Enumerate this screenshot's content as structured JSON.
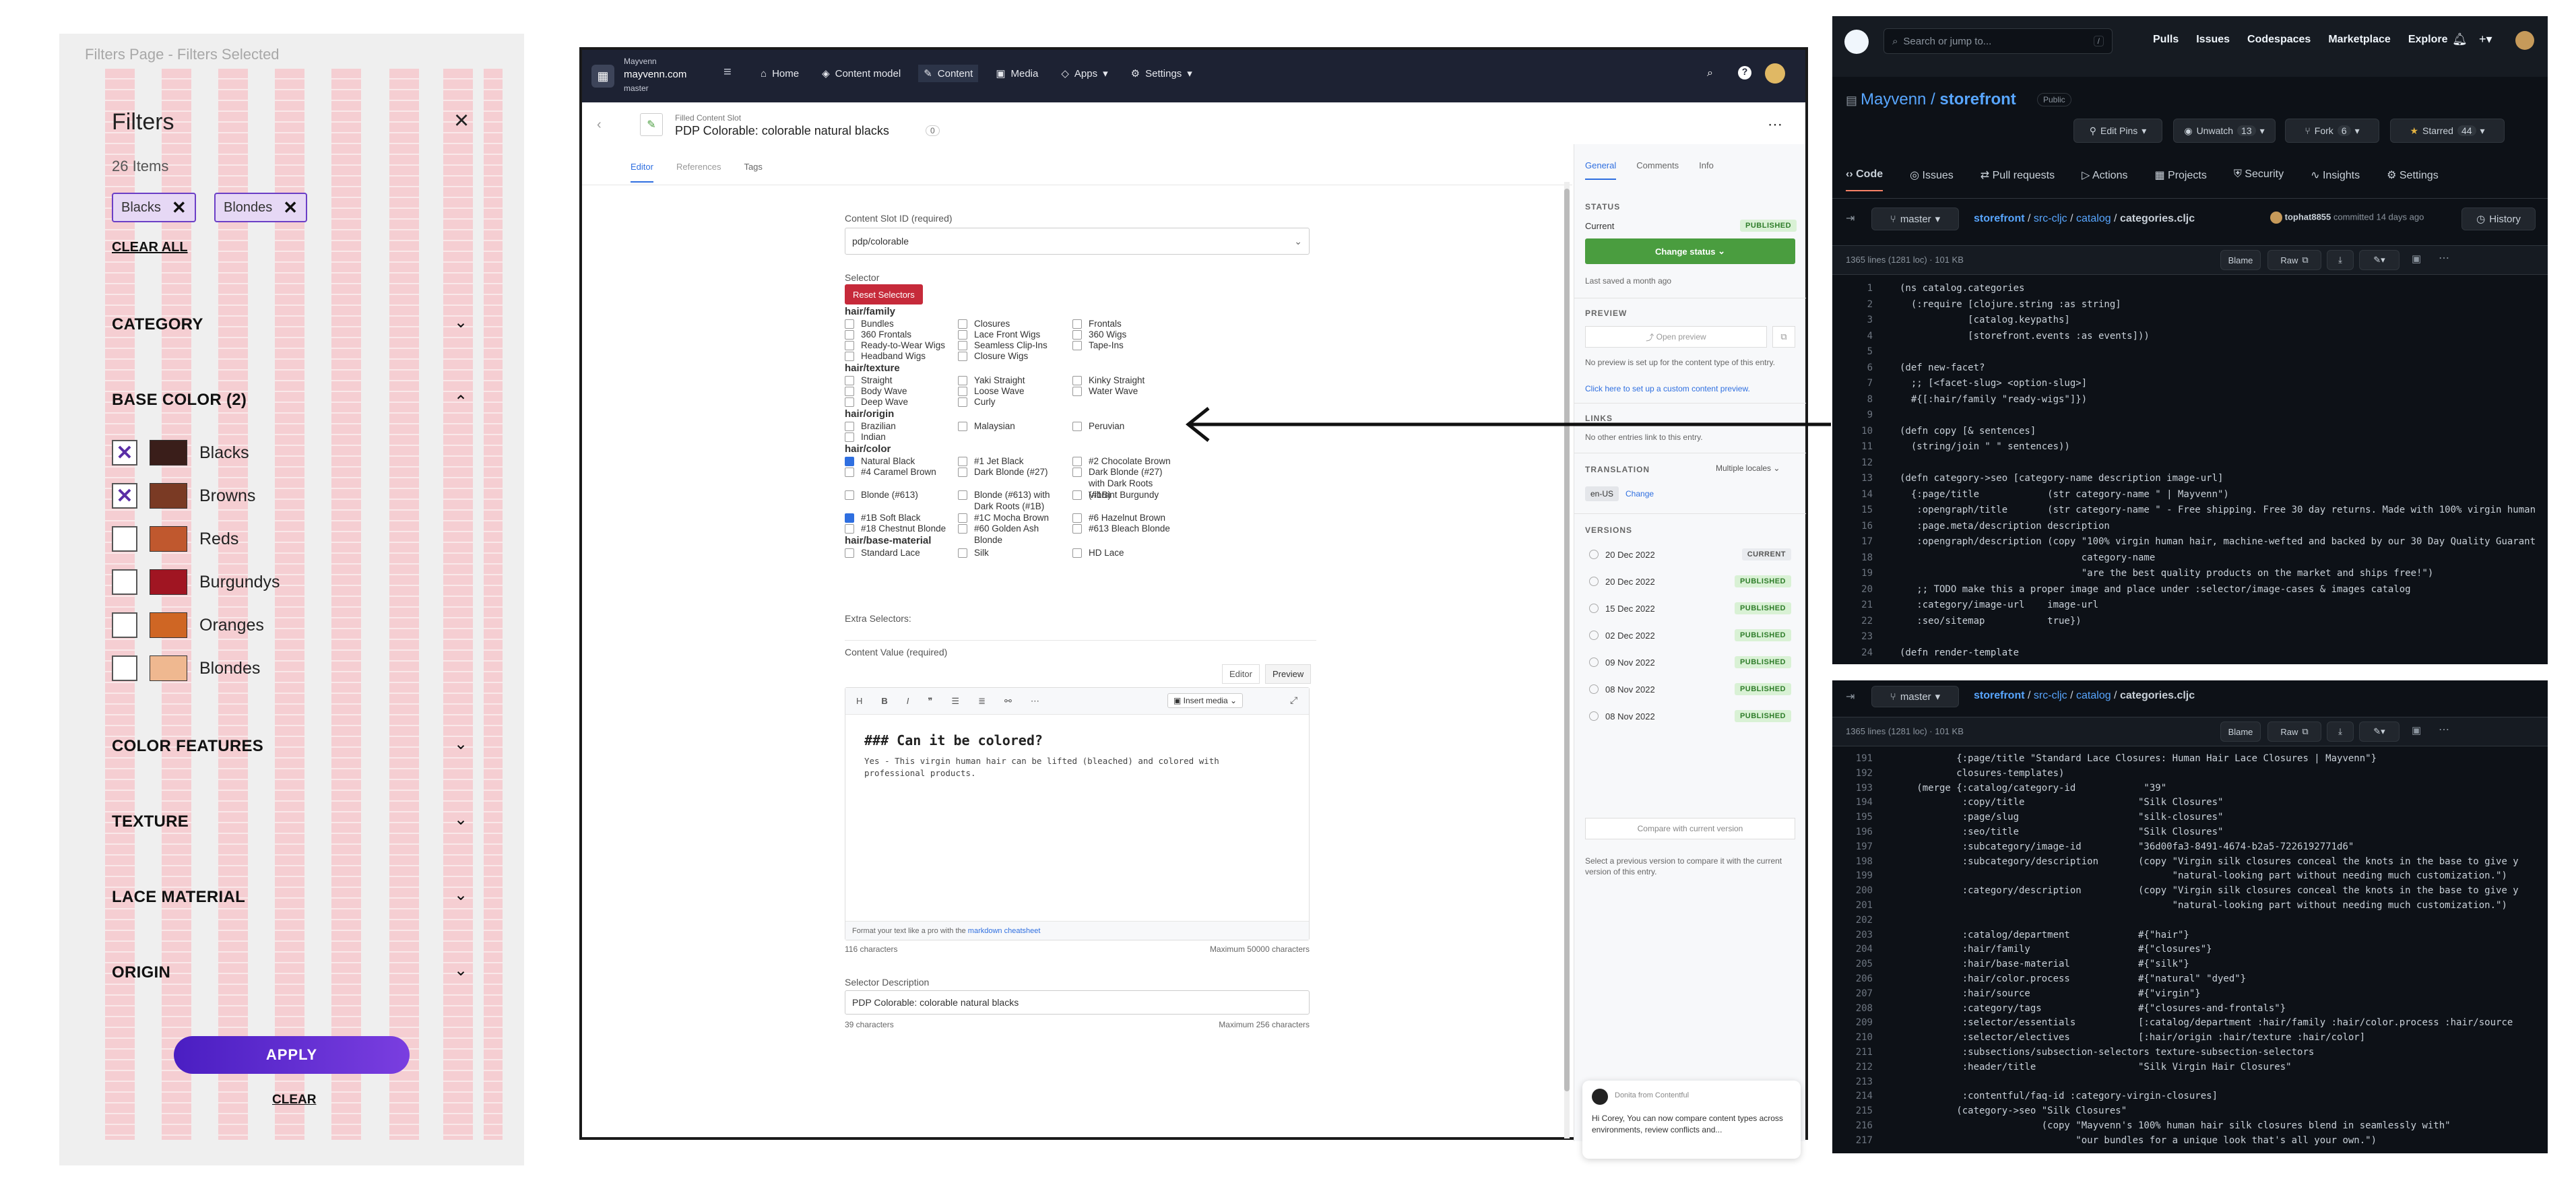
{
  "filters_panel": {
    "caption": "Filters Page - Filters Selected",
    "title": "Filters",
    "count": "26 Items",
    "chips": [
      "Blacks",
      "Blondes"
    ],
    "clear_all": "CLEAR ALL",
    "sections": {
      "category": "CATEGORY",
      "base_color": "BASE COLOR (2)",
      "color_features": "COLOR FEATURES",
      "texture": "TEXTURE",
      "lace_material": "LACE MATERIAL",
      "origin": "ORIGIN"
    },
    "colors": [
      {
        "label": "Blacks",
        "checked": true,
        "swatch": "#3a1e1a"
      },
      {
        "label": "Browns",
        "checked": true,
        "swatch": "#7a3a24"
      },
      {
        "label": "Reds",
        "checked": false,
        "swatch": "#c0582e"
      },
      {
        "label": "Burgundys",
        "checked": false,
        "swatch": "#a01522"
      },
      {
        "label": "Oranges",
        "checked": false,
        "swatch": "#cf6624"
      },
      {
        "label": "Blondes",
        "checked": false,
        "swatch": "#efb890"
      }
    ],
    "apply": "APPLY",
    "clear": "CLEAR"
  },
  "cms": {
    "space": "Mayvenn",
    "site": "mayvenn.com",
    "branch": "master",
    "nav": [
      "Home",
      "Content model",
      "Content",
      "Media",
      "Apps",
      "Settings"
    ],
    "entry_type": "Filled Content Slot",
    "entry_title": "PDP Colorable: colorable natural blacks",
    "entry_refs": "0",
    "tabs": [
      "Editor",
      "References",
      "Tags"
    ],
    "slot_label": "Content Slot ID (required)",
    "slot_value": "pdp/colorable",
    "selector_label": "Selector",
    "reset_button": "Reset Selectors",
    "groups": [
      {
        "name": "hair/family",
        "options": [
          [
            "Bundles",
            "Closures",
            "Frontals"
          ],
          [
            "360 Frontals",
            "Lace Front Wigs",
            "360 Wigs"
          ],
          [
            "Ready-to-Wear Wigs",
            "Seamless Clip-Ins",
            "Tape-Ins"
          ],
          [
            "Headband Wigs",
            "Closure Wigs",
            ""
          ]
        ],
        "checked": []
      },
      {
        "name": "hair/texture",
        "options": [
          [
            "Straight",
            "Yaki Straight",
            "Kinky Straight"
          ],
          [
            "Body Wave",
            "Loose Wave",
            "Water Wave"
          ],
          [
            "Deep Wave",
            "Curly",
            ""
          ]
        ],
        "checked": []
      },
      {
        "name": "hair/origin",
        "options": [
          [
            "Brazilian",
            "Malaysian",
            "Peruvian"
          ],
          [
            "Indian",
            "",
            ""
          ]
        ],
        "checked": []
      },
      {
        "name": "hair/color",
        "options": [
          [
            "Natural Black",
            "#1 Jet Black",
            "#2 Chocolate Brown"
          ],
          [
            "#4 Caramel Brown",
            "Dark Blonde (#27)",
            "Dark Blonde (#27) with Dark Roots (#1B)"
          ],
          [
            "Blonde (#613)",
            "Blonde (#613) with Dark Roots (#1B)",
            "Vibrant Burgundy"
          ],
          [
            "#1B Soft Black",
            "#1C Mocha Brown",
            "#6 Hazelnut Brown"
          ],
          [
            "#18 Chestnut Blonde",
            "#60 Golden Ash Blonde",
            "#613 Bleach Blonde"
          ]
        ],
        "checked": [
          "Natural Black",
          "#1B Soft Black"
        ]
      },
      {
        "name": "hair/base-material",
        "options": [
          [
            "Standard Lace",
            "Silk",
            "HD Lace"
          ]
        ],
        "checked": []
      }
    ],
    "extra_selectors": "Extra Selectors:",
    "content_value_label": "Content Value (required)",
    "editor_tabs": [
      "Editor",
      "Preview"
    ],
    "insert_media": "Insert media",
    "content_heading": "### Can it be colored?",
    "content_body": "Yes - This virgin human hair can be lifted (bleached) and colored with\nprofessional products.",
    "format_hint": "Format your text like a pro with the",
    "format_link": "markdown cheatsheet",
    "char_count": "116 characters",
    "char_max": "Maximum 50000 characters",
    "desc_label": "Selector Description",
    "desc_value": "PDP Colorable: colorable natural blacks",
    "desc_count": "39 characters",
    "desc_max": "Maximum 256 characters",
    "side_tabs": [
      "General",
      "Comments",
      "Info"
    ],
    "status_head": "STATUS",
    "current": "Current",
    "published": "PUBLISHED",
    "change_status": "Change status",
    "last_saved": "Last saved a month ago",
    "preview_head": "PREVIEW",
    "open_preview": "Open preview",
    "preview_note": "No preview is set up for the content type of this entry.",
    "preview_link": "Click here to set up a custom content preview.",
    "links_head": "LINKS",
    "links_note": "No other entries link to this entry.",
    "translation_head": "TRANSLATION",
    "locales": "Multiple locales",
    "locale": "en-US",
    "change": "Change",
    "versions_head": "VERSIONS",
    "versions": [
      {
        "date": "20 Dec 2022",
        "status": "CURRENT"
      },
      {
        "date": "20 Dec 2022",
        "status": "PUBLISHED"
      },
      {
        "date": "15 Dec 2022",
        "status": "PUBLISHED"
      },
      {
        "date": "02 Dec 2022",
        "status": "PUBLISHED"
      },
      {
        "date": "09 Nov 2022",
        "status": "PUBLISHED"
      },
      {
        "date": "08 Nov 2022",
        "status": "PUBLISHED"
      },
      {
        "date": "08 Nov 2022",
        "status": "PUBLISHED"
      }
    ],
    "compare_button": "Compare with current version",
    "compare_note": "Select a previous version to compare it with the current version of this entry.",
    "chat_from": "Donita from Contentful",
    "chat_text": "Hi Corey, You can now compare content types across environments, review conflicts and..."
  },
  "github": {
    "search": "Search or jump to...",
    "nav": [
      "Pulls",
      "Issues",
      "Codespaces",
      "Marketplace",
      "Explore"
    ],
    "owner": "Mayvenn",
    "repo": "storefront",
    "visibility": "Public",
    "pins": "Edit Pins",
    "unwatch": "Unwatch",
    "unwatch_count": "13",
    "fork": "Fork",
    "fork_count": "6",
    "starred": "Starred",
    "star_count": "44",
    "tabs": [
      "Code",
      "Issues",
      "Pull requests",
      "Actions",
      "Projects",
      "Security",
      "Insights",
      "Settings"
    ],
    "branch": "master",
    "path": [
      "storefront",
      "src-cljc",
      "catalog",
      "categories.cljc"
    ],
    "author": "tophat8855",
    "commit_note": "committed 14 days ago",
    "history": "History",
    "file_info": "1365 lines (1281 loc) · 101 KB",
    "blame": "Blame",
    "raw": "Raw",
    "lines_top": [
      [
        "1",
        "(ns catalog.categories"
      ],
      [
        "2",
        "  (:require [clojure.string :as string]"
      ],
      [
        "3",
        "            [catalog.keypaths]"
      ],
      [
        "4",
        "            [storefront.events :as events]))"
      ],
      [
        "5",
        ""
      ],
      [
        "6",
        "(def new-facet?"
      ],
      [
        "7",
        "  ;; [<facet-slug> <option-slug>]"
      ],
      [
        "8",
        "  #{[:hair/family \"ready-wigs\"]})"
      ],
      [
        "9",
        ""
      ],
      [
        "10",
        "(defn copy [& sentences]"
      ],
      [
        "11",
        "  (string/join \" \" sentences))"
      ],
      [
        "12",
        ""
      ],
      [
        "13",
        "(defn category->seo [category-name description image-url]"
      ],
      [
        "14",
        "  {:page/title            (str category-name \" | Mayvenn\")"
      ],
      [
        "15",
        "   :opengraph/title       (str category-name \" - Free shipping. Free 30 day returns. Made with 100% virgin human"
      ],
      [
        "16",
        "   :page.meta/description description"
      ],
      [
        "17",
        "   :opengraph/description (copy \"100% virgin human hair, machine-wefted and backed by our 30 Day Quality Guarant"
      ],
      [
        "18",
        "                                category-name"
      ],
      [
        "19",
        "                                \"are the best quality products on the market and ships free!\")"
      ],
      [
        "20",
        "   ;; TODO make this a proper image and place under :selector/image-cases & images catalog"
      ],
      [
        "21",
        "   :category/image-url    image-url"
      ],
      [
        "22",
        "   :seo/sitemap           true})"
      ],
      [
        "23",
        ""
      ],
      [
        "24",
        "(defn render-template"
      ]
    ],
    "lines_bottom": [
      [
        "191",
        "          {:page/title \"Standard Lace Closures: Human Hair Lace Closures | Mayvenn\"}"
      ],
      [
        "192",
        "          closures-templates)"
      ],
      [
        "193",
        "   (merge {:catalog/category-id            \"39\""
      ],
      [
        "194",
        "           :copy/title                    \"Silk Closures\""
      ],
      [
        "195",
        "           :page/slug                     \"silk-closures\""
      ],
      [
        "196",
        "           :seo/title                     \"Silk Closures\""
      ],
      [
        "197",
        "           :subcategory/image-id          \"36d00fa3-8491-4674-b2a5-7226192771d6\""
      ],
      [
        "198",
        "           :subcategory/description       (copy \"Virgin silk closures conceal the knots in the base to give y"
      ],
      [
        "199",
        "                                                \"natural-looking part without needing much customization.\")"
      ],
      [
        "200",
        "           :category/description          (copy \"Virgin silk closures conceal the knots in the base to give y"
      ],
      [
        "201",
        "                                                \"natural-looking part without needing much customization.\")"
      ],
      [
        "202",
        ""
      ],
      [
        "203",
        "           :catalog/department            #{\"hair\"}"
      ],
      [
        "204",
        "           :hair/family                   #{\"closures\"}"
      ],
      [
        "205",
        "           :hair/base-material            #{\"silk\"}"
      ],
      [
        "206",
        "           :hair/color.process            #{\"natural\" \"dyed\"}"
      ],
      [
        "207",
        "           :hair/source                   #{\"virgin\"}"
      ],
      [
        "208",
        "           :category/tags                 #{\"closures-and-frontals\"}"
      ],
      [
        "209",
        "           :selector/essentials           [:catalog/department :hair/family :hair/color.process :hair/source"
      ],
      [
        "210",
        "           :selector/electives            [:hair/origin :hair/texture :hair/color]"
      ],
      [
        "211",
        "           :subsections/subsection-selectors texture-subsection-selectors"
      ],
      [
        "212",
        "           :header/title                  \"Silk Virgin Hair Closures\""
      ],
      [
        "213",
        ""
      ],
      [
        "214",
        "           :contentful/faq-id :category-virgin-closures]"
      ],
      [
        "215",
        "          (category->seo \"Silk Closures\""
      ],
      [
        "216",
        "                         (copy \"Mayvenn's 100% human hair silk closures blend in seamlessly with\""
      ],
      [
        "217",
        "                               \"our bundles for a unique look that's all your own.\")"
      ]
    ]
  }
}
